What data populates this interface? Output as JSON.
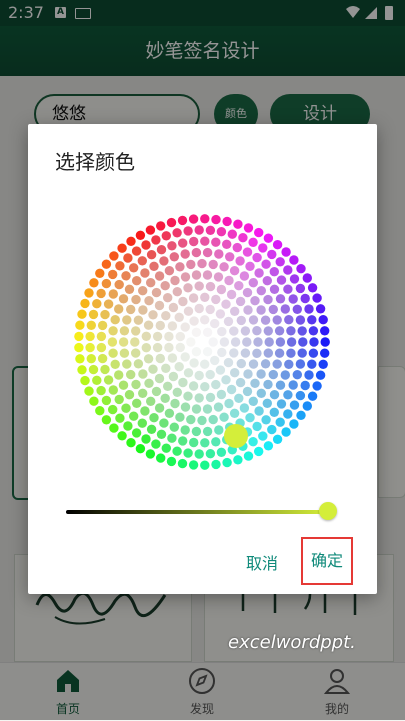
{
  "status_bar": {
    "time": "2:37",
    "a_icon": "A"
  },
  "app_bar": {
    "title": "妙笔签名设计"
  },
  "form": {
    "name_value": "悠悠",
    "color_button": "颜色",
    "design_button": "设计"
  },
  "dialog": {
    "title": "选择颜色",
    "cancel": "取消",
    "ok": "确定",
    "selected_color": "#d4ee3a",
    "lightness": 1.0
  },
  "nav": {
    "home": "首页",
    "discover": "发现",
    "mine": "我的"
  },
  "watermark": "excelwordppt.",
  "colors": {
    "primary": "#0f5a3a",
    "accent_text": "#0f8a7a",
    "highlight": "#e53935"
  }
}
